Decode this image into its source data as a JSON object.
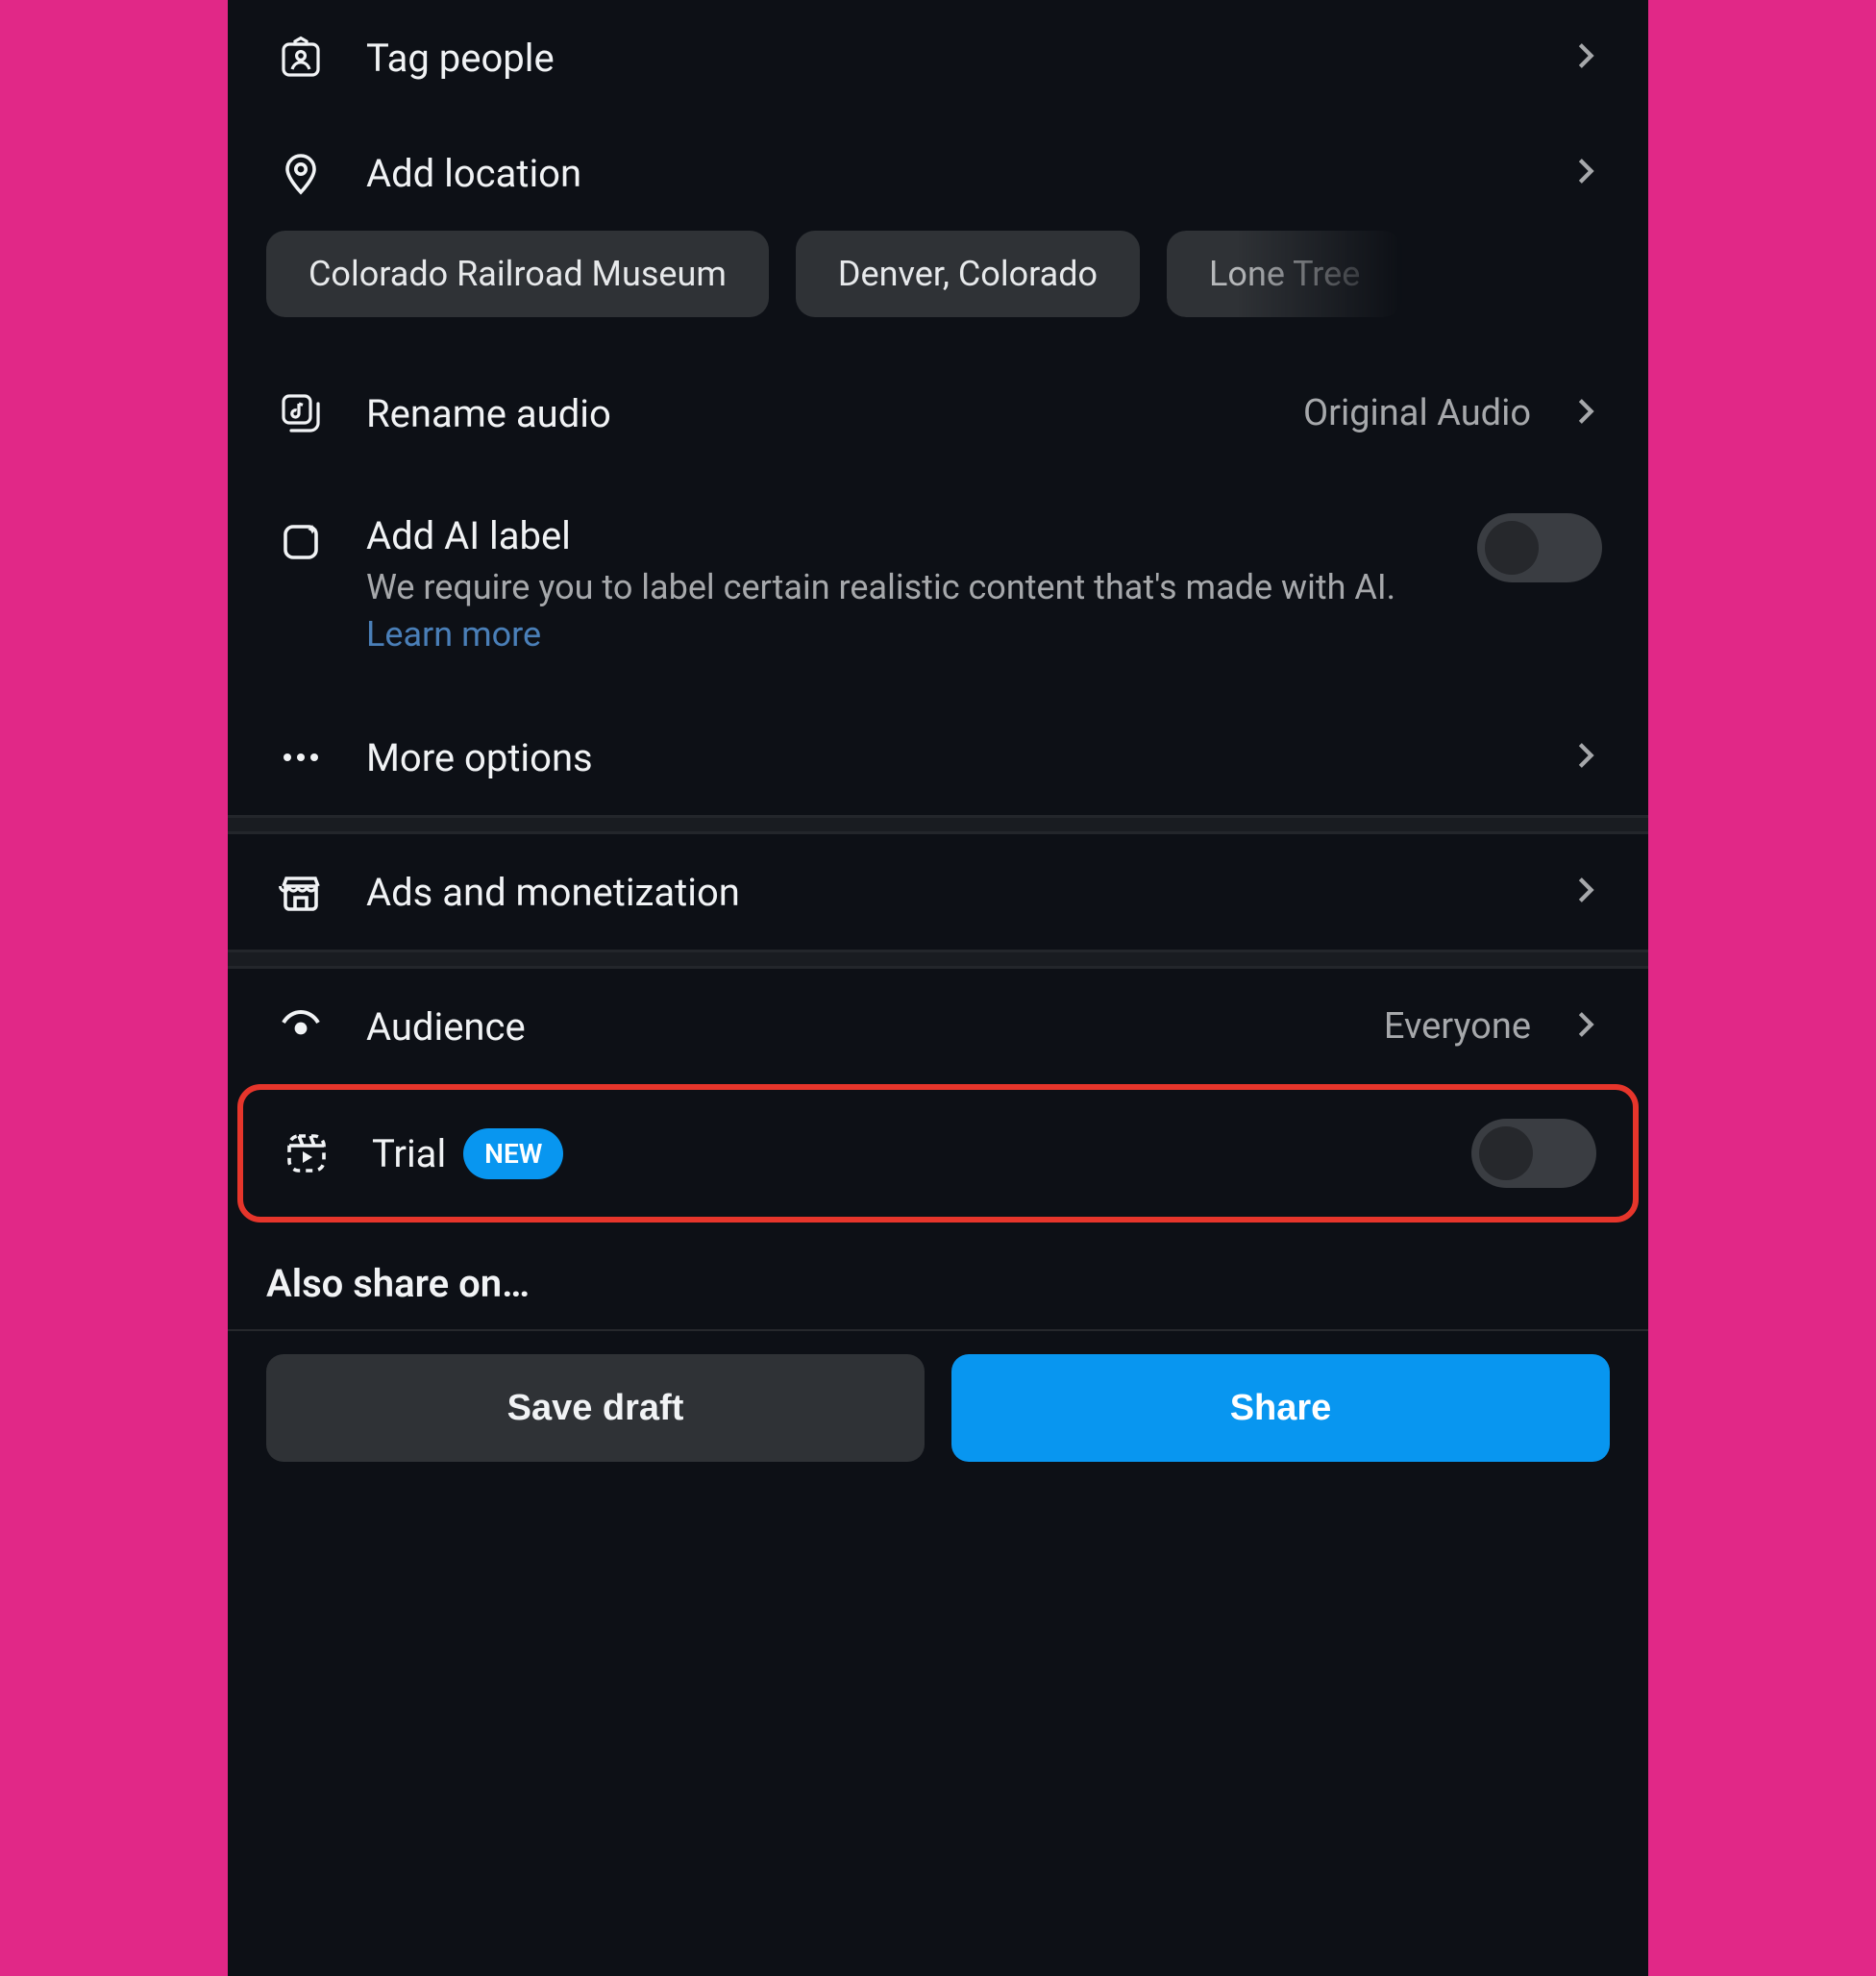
{
  "rows": {
    "tag_people": {
      "label": "Tag people"
    },
    "add_location": {
      "label": "Add location"
    },
    "rename_audio": {
      "label": "Rename audio",
      "value": "Original Audio"
    },
    "ai_label": {
      "label": "Add AI label",
      "desc": "We require you to label certain realistic content that's made with AI. ",
      "learn_more": "Learn more"
    },
    "more_options": {
      "label": "More options"
    },
    "ads": {
      "label": "Ads and monetization"
    },
    "audience": {
      "label": "Audience",
      "value": "Everyone"
    },
    "trial": {
      "label": "Trial",
      "badge": "NEW"
    }
  },
  "location_chips": [
    "Colorado Railroad Museum",
    "Denver, Colorado",
    "Lone Tree"
  ],
  "share_section_title": "Also share on…",
  "buttons": {
    "draft": "Save draft",
    "share": "Share"
  }
}
